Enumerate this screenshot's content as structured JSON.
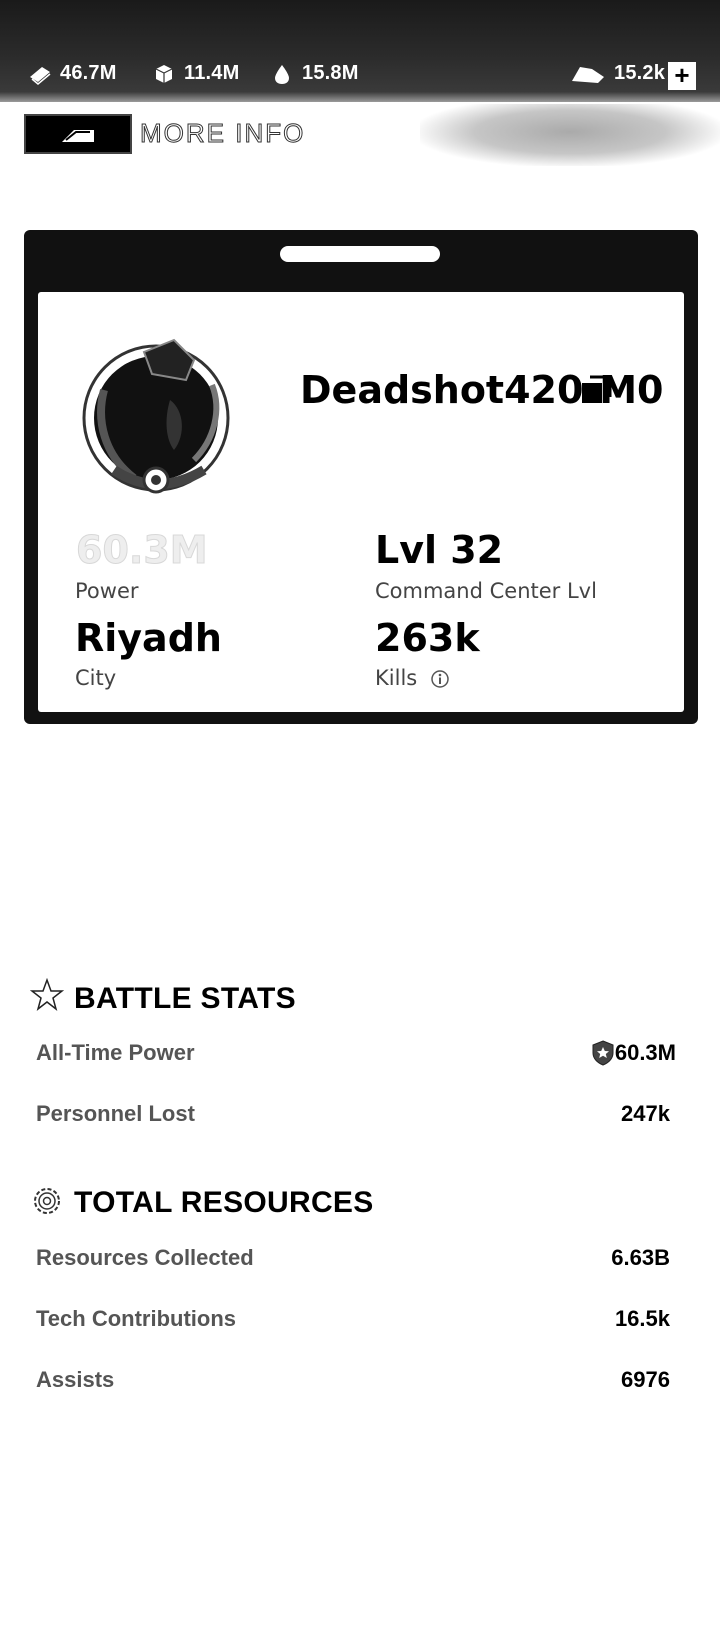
{
  "resources": {
    "money": "46.7M",
    "parts": "11.4M",
    "oil": "15.8M",
    "gold": "15.2k",
    "add_label": "+"
  },
  "header": {
    "title": "MORE INFO"
  },
  "profile": {
    "name": "Deadshot420-M0",
    "power_value": "60.3M",
    "power_label": "Power",
    "level_value": "Lvl 32",
    "level_label": "Command Center Lvl",
    "city_value": "Riyadh",
    "city_label": "City",
    "kills_value": "263k",
    "kills_label": "Kills"
  },
  "battle_stats": {
    "title": "BATTLE STATS",
    "rows": [
      {
        "label": "All-Time Power",
        "value": "60.3M"
      },
      {
        "label": "Personnel Lost",
        "value": "247k"
      }
    ]
  },
  "total_resources": {
    "title": "TOTAL RESOURCES",
    "rows": [
      {
        "label": "Resources Collected",
        "value": "6.63B"
      },
      {
        "label": "Tech Contributions",
        "value": "16.5k"
      },
      {
        "label": "Assists",
        "value": "6976"
      }
    ]
  },
  "colors": {
    "topbar": "#2b2b2b",
    "card_frame": "#111111",
    "label_gray": "#555555"
  }
}
